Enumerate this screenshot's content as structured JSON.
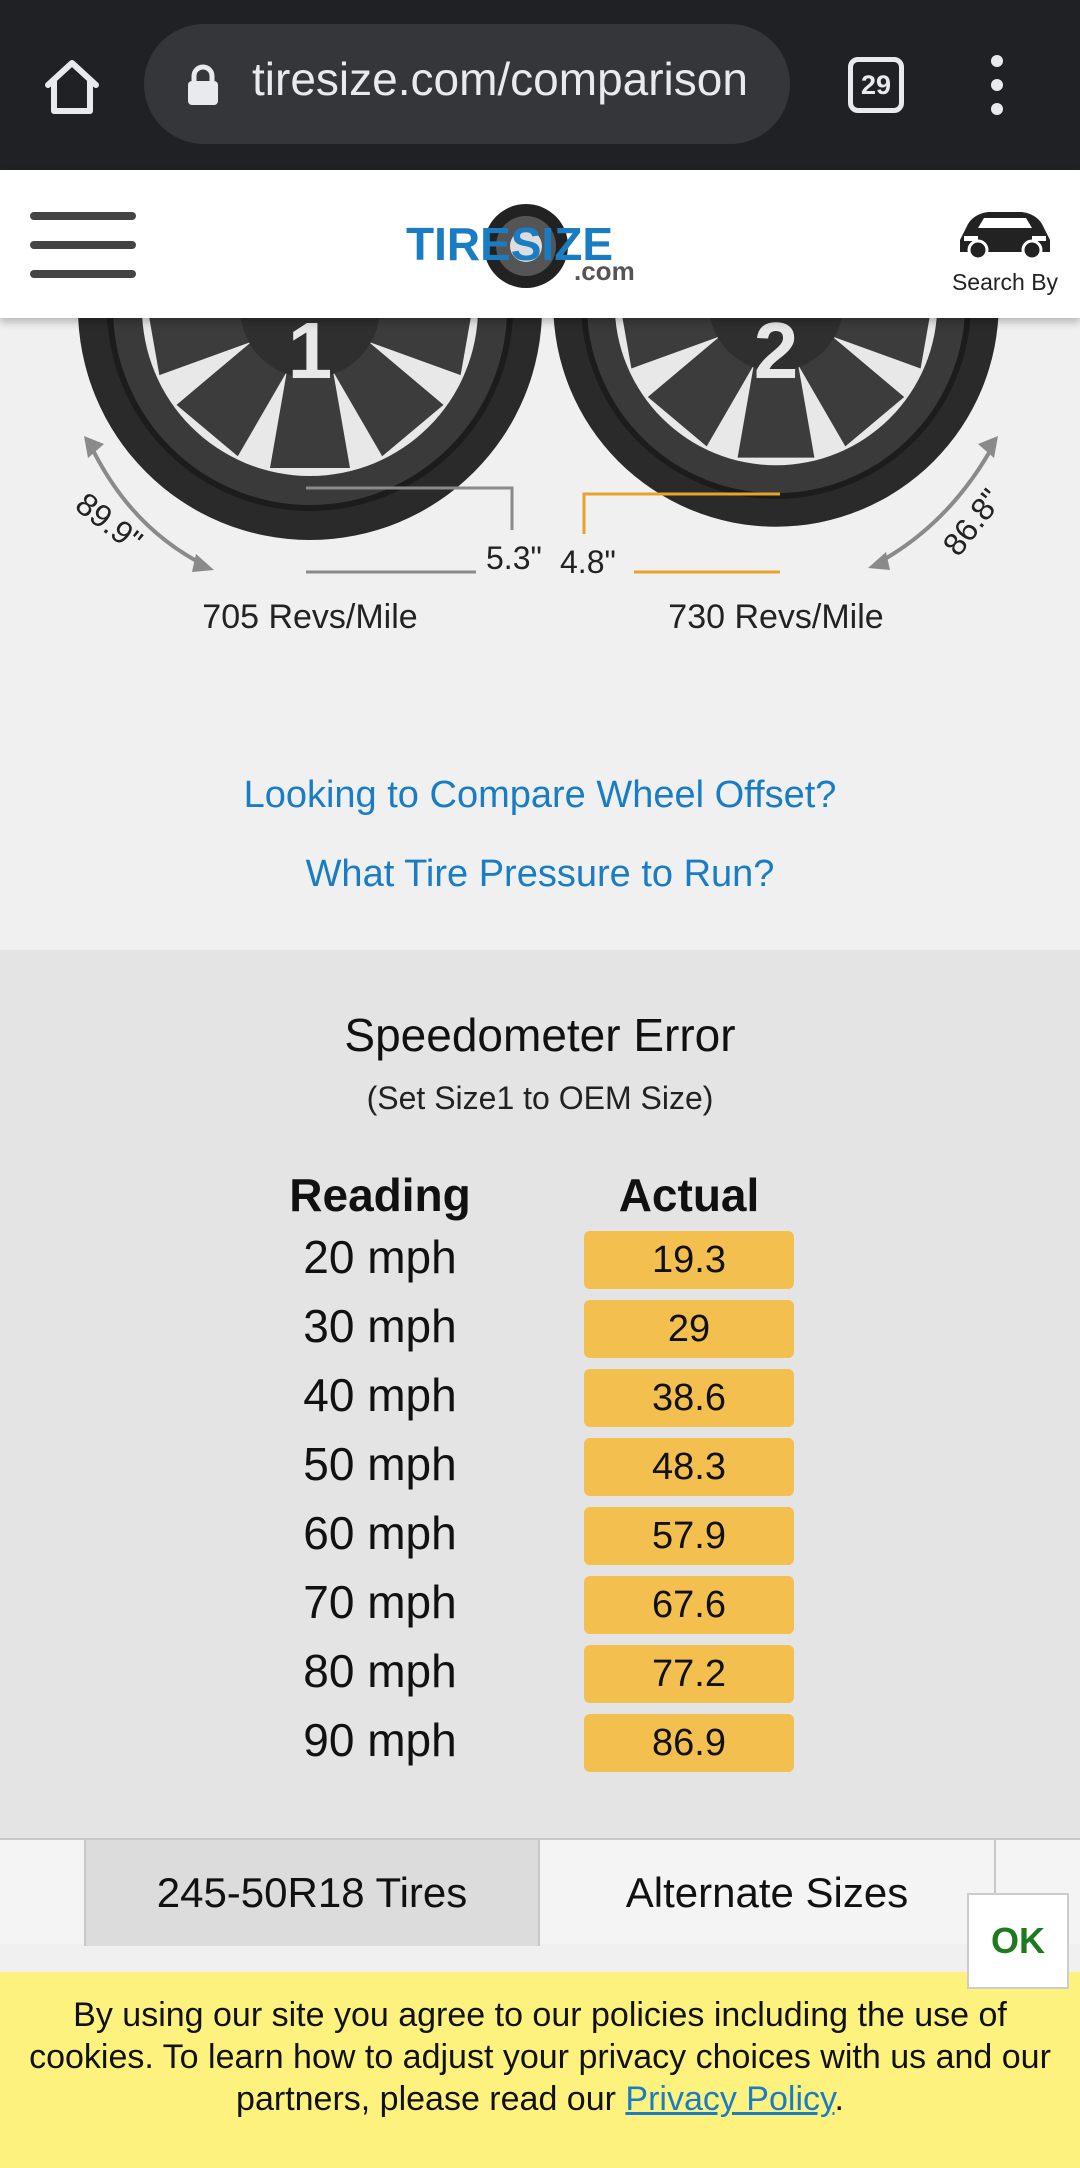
{
  "browser": {
    "url": "tiresize.com/comparison",
    "tab_count": "29"
  },
  "header": {
    "logo_text_top": "TIRESIZE",
    "logo_text_bottom": ".com",
    "search_by_label": "Search By"
  },
  "tires": {
    "tire1": {
      "number": "1",
      "height_label": "89.9\"",
      "width_label": "5.3\"",
      "revs_label": "705 Revs/Mile"
    },
    "tire2": {
      "number": "2",
      "height_label": "86.8\"",
      "width_label": "4.8\"",
      "revs_label": "730 Revs/Mile"
    }
  },
  "links": {
    "wheel_offset": "Looking to Compare Wheel Offset?",
    "tire_pressure": "What Tire Pressure to Run?"
  },
  "speedometer": {
    "title": "Speedometer Error",
    "subtitle": "(Set Size1 to OEM Size)",
    "col_reading": "Reading",
    "col_actual": "Actual",
    "rows": [
      {
        "reading": "20 mph",
        "actual": "19.3"
      },
      {
        "reading": "30 mph",
        "actual": "29"
      },
      {
        "reading": "40 mph",
        "actual": "38.6"
      },
      {
        "reading": "50 mph",
        "actual": "48.3"
      },
      {
        "reading": "60 mph",
        "actual": "57.9"
      },
      {
        "reading": "70 mph",
        "actual": "67.6"
      },
      {
        "reading": "80 mph",
        "actual": "77.2"
      },
      {
        "reading": "90 mph",
        "actual": "86.9"
      }
    ]
  },
  "tabbar": {
    "tab_tires": "245-50R18 Tires",
    "tab_alternate": "Alternate Sizes"
  },
  "cookie": {
    "text_before_link": "By using our site you agree to our policies including the use of cookies. To learn how to adjust your privacy choices with us and our partners, please read our ",
    "link_text": "Privacy Policy",
    "text_after_link": ".",
    "ok_label": "OK"
  },
  "colors": {
    "accent_link": "#1a7dc4",
    "actual_highlight": "#f3bf4f",
    "cookie_bg": "#fef27f",
    "ok_green": "#1e7a1e"
  }
}
